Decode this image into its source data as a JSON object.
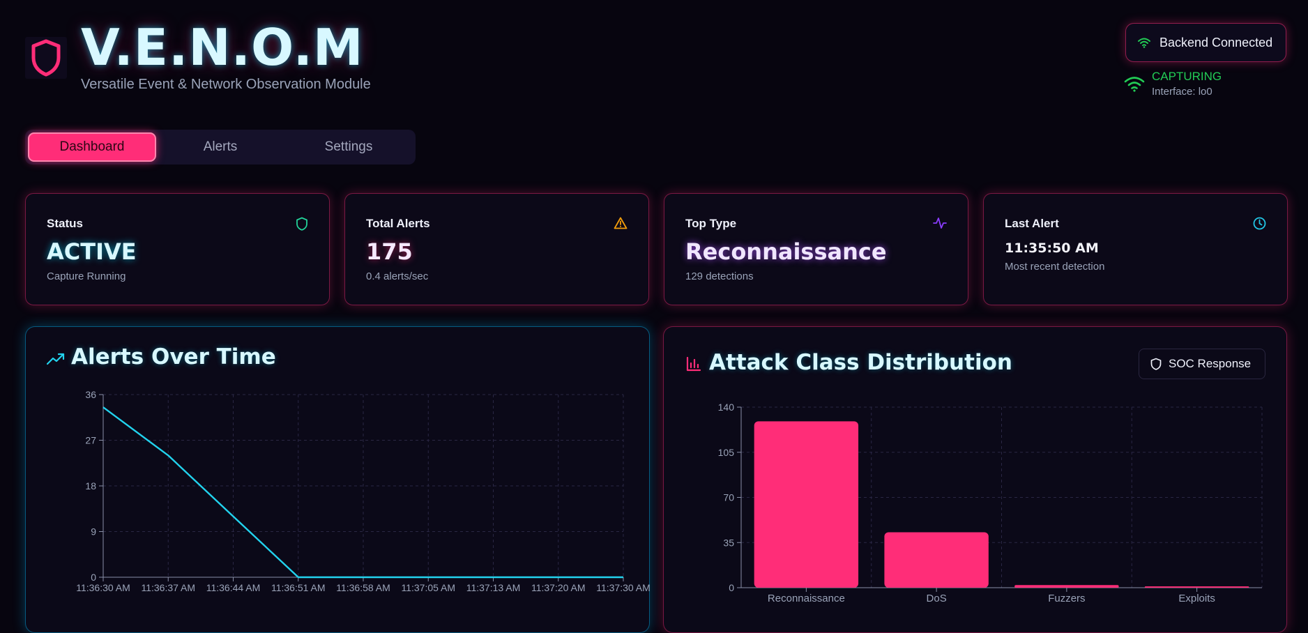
{
  "app": {
    "title": "V.E.N.O.M",
    "subtitle": "Versatile Event & Network Observation Module"
  },
  "connection": {
    "backend_label": "Backend Connected",
    "capture_status": "CAPTURING",
    "interface_label": "Interface: lo0"
  },
  "nav": {
    "tabs": [
      {
        "label": "Dashboard",
        "active": true
      },
      {
        "label": "Alerts",
        "active": false
      },
      {
        "label": "Settings",
        "active": false
      }
    ]
  },
  "stats": {
    "status": {
      "label": "Status",
      "value": "ACTIVE",
      "sub": "Capture Running",
      "icon": "shield-icon",
      "color": "#22d39a"
    },
    "total_alerts": {
      "label": "Total Alerts",
      "value": "175",
      "sub": "0.4 alerts/sec",
      "icon": "warning-icon",
      "color": "#f59e0b"
    },
    "top_type": {
      "label": "Top Type",
      "value": "Reconnaissance",
      "sub": "129 detections",
      "icon": "activity-icon",
      "color": "#8b3dff"
    },
    "last_alert": {
      "label": "Last Alert",
      "value": "11:35:50 AM",
      "sub": "Most recent detection",
      "icon": "clock-icon",
      "color": "#22c7e6"
    }
  },
  "panels": {
    "alerts_over_time": {
      "title": "Alerts Over Time",
      "icon": "trending-up-icon"
    },
    "attack_distribution": {
      "title": "Attack Class Distribution",
      "icon": "bar-chart-icon",
      "soc_button": "SOC Response"
    }
  },
  "colors": {
    "accent": "#ff2d78",
    "cyan": "#22d3ee",
    "bg": "#07050f"
  },
  "chart_data": [
    {
      "type": "line",
      "x": [
        "11:36:30 AM",
        "11:36:37 AM",
        "11:36:44 AM",
        "11:36:51 AM",
        "11:36:58 AM",
        "11:37:05 AM",
        "11:37:13 AM",
        "11:37:20 AM",
        "11:37:30 AM"
      ],
      "series": [
        {
          "values": [
            33.5,
            24,
            12,
            0,
            0,
            0,
            0,
            0,
            0
          ]
        }
      ],
      "ylim": [
        0,
        36
      ],
      "yticks": [
        0,
        9,
        18,
        27,
        36
      ],
      "grid": true
    },
    {
      "type": "bar",
      "categories": [
        "Reconnaissance",
        "DoS",
        "Fuzzers",
        "Exploits"
      ],
      "values": [
        129,
        43,
        2,
        1
      ],
      "ylim": [
        0,
        140
      ],
      "yticks": [
        0,
        35,
        70,
        105,
        140
      ],
      "grid": true
    }
  ]
}
